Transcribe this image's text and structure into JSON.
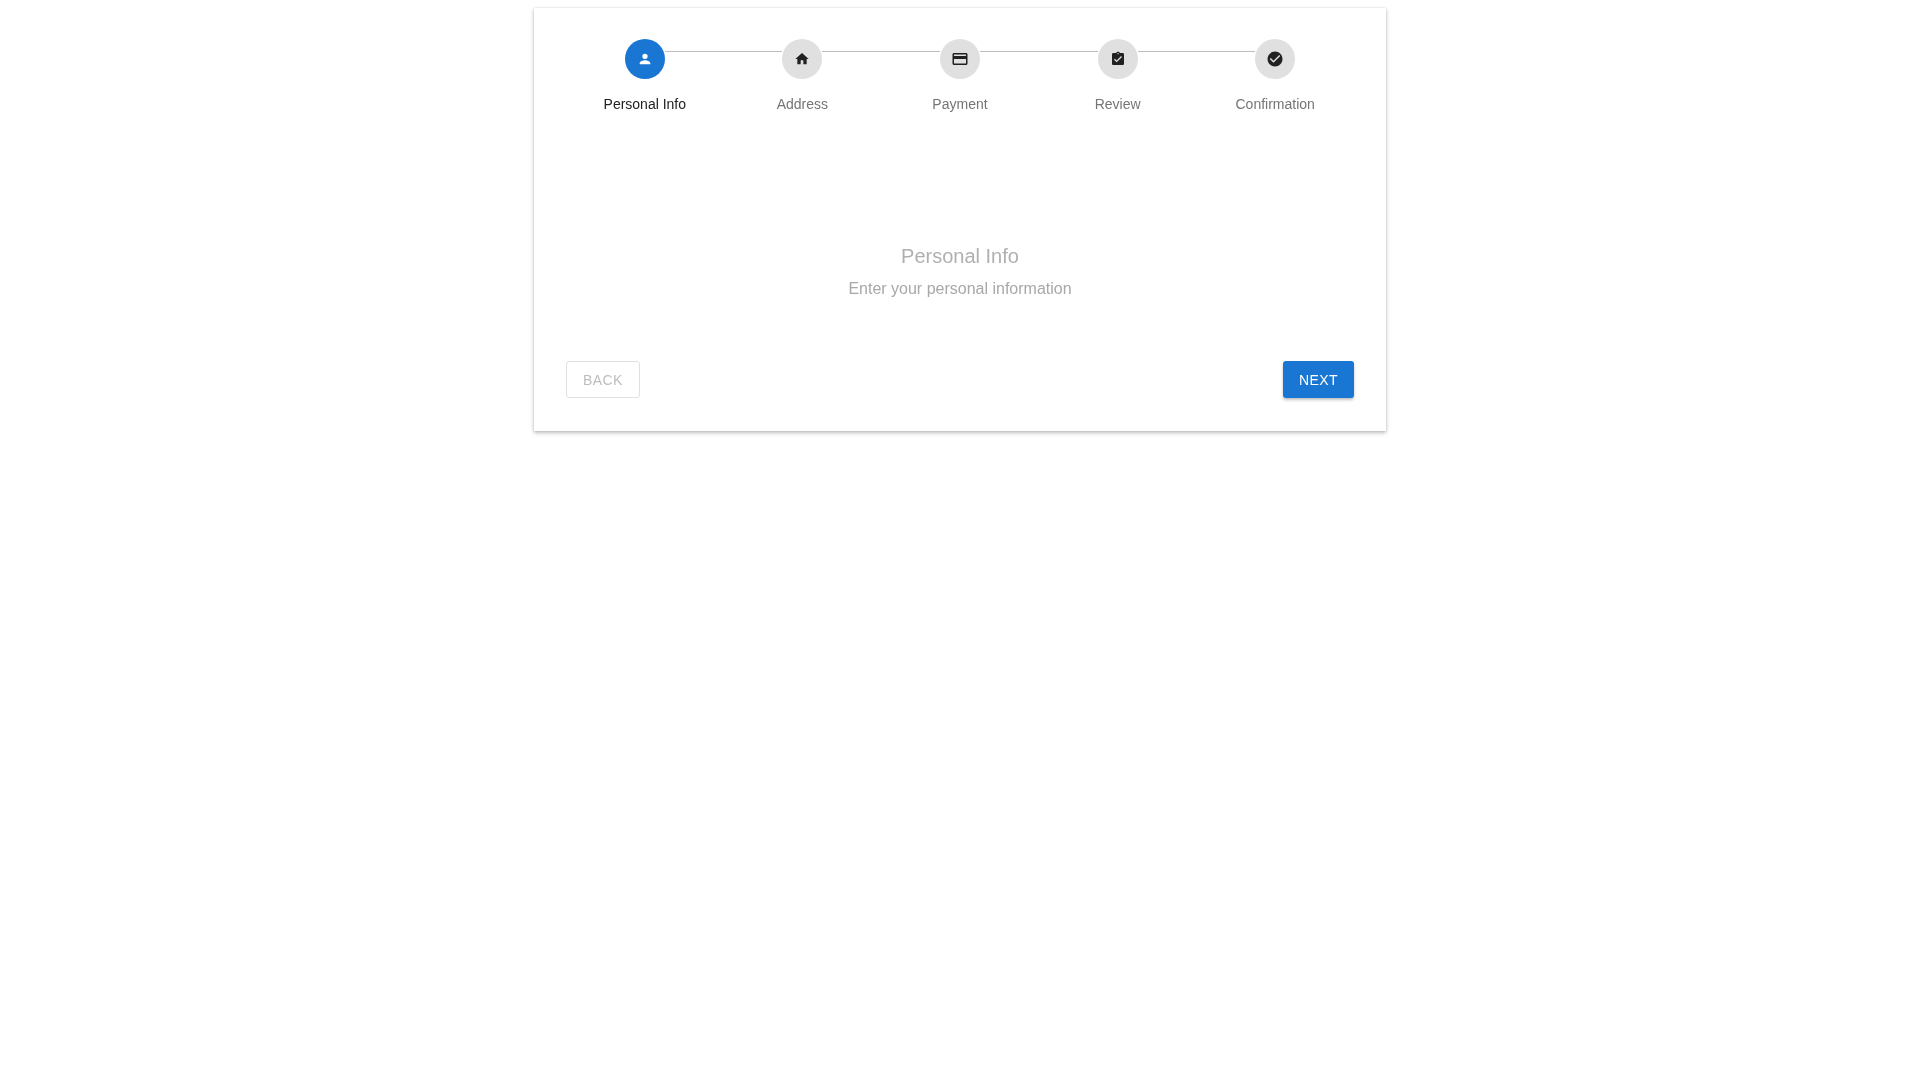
{
  "steps": [
    {
      "label": "Personal Info",
      "selected": true
    },
    {
      "label": "Address",
      "selected": false
    },
    {
      "label": "Payment",
      "selected": false
    },
    {
      "label": "Review",
      "selected": false
    },
    {
      "label": "Confirmation",
      "selected": false
    }
  ],
  "content": {
    "title": "Personal Info",
    "subtitle": "Enter your personal information"
  },
  "buttons": {
    "back": {
      "label": "BACK",
      "disabled": true
    },
    "next": {
      "label": "NEXT",
      "disabled": false
    }
  }
}
